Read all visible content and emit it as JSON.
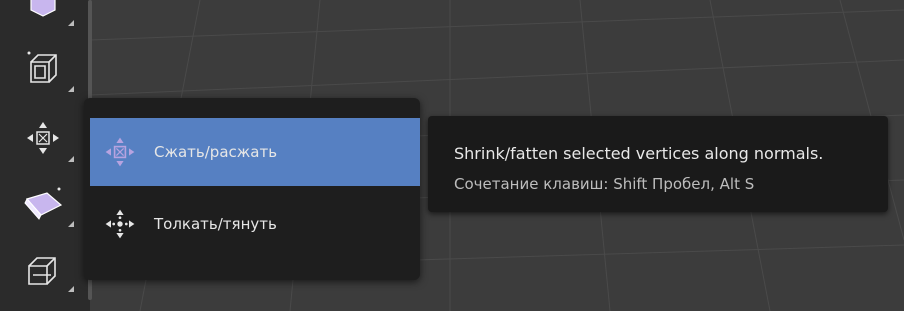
{
  "toolbar": {
    "tools": [
      {
        "icon": "extrude-region-icon"
      },
      {
        "icon": "inset-faces-icon"
      },
      {
        "icon": "shrink-fatten-icon"
      },
      {
        "icon": "bevel-icon"
      },
      {
        "icon": "loop-cut-icon"
      }
    ]
  },
  "flyout": {
    "items": [
      {
        "label": "Сжать/расжать",
        "icon": "shrink-fatten-icon",
        "active": true
      },
      {
        "label": "Толкать/тянуть",
        "icon": "push-pull-icon",
        "active": false
      }
    ]
  },
  "tooltip": {
    "title": "Shrink/fatten selected vertices along normals.",
    "shortcut": "Сочетание клавиш: Shift Пробел, Alt S"
  },
  "colors": {
    "accent": "#5680c2",
    "icon_purple": "#b7a3e0"
  }
}
